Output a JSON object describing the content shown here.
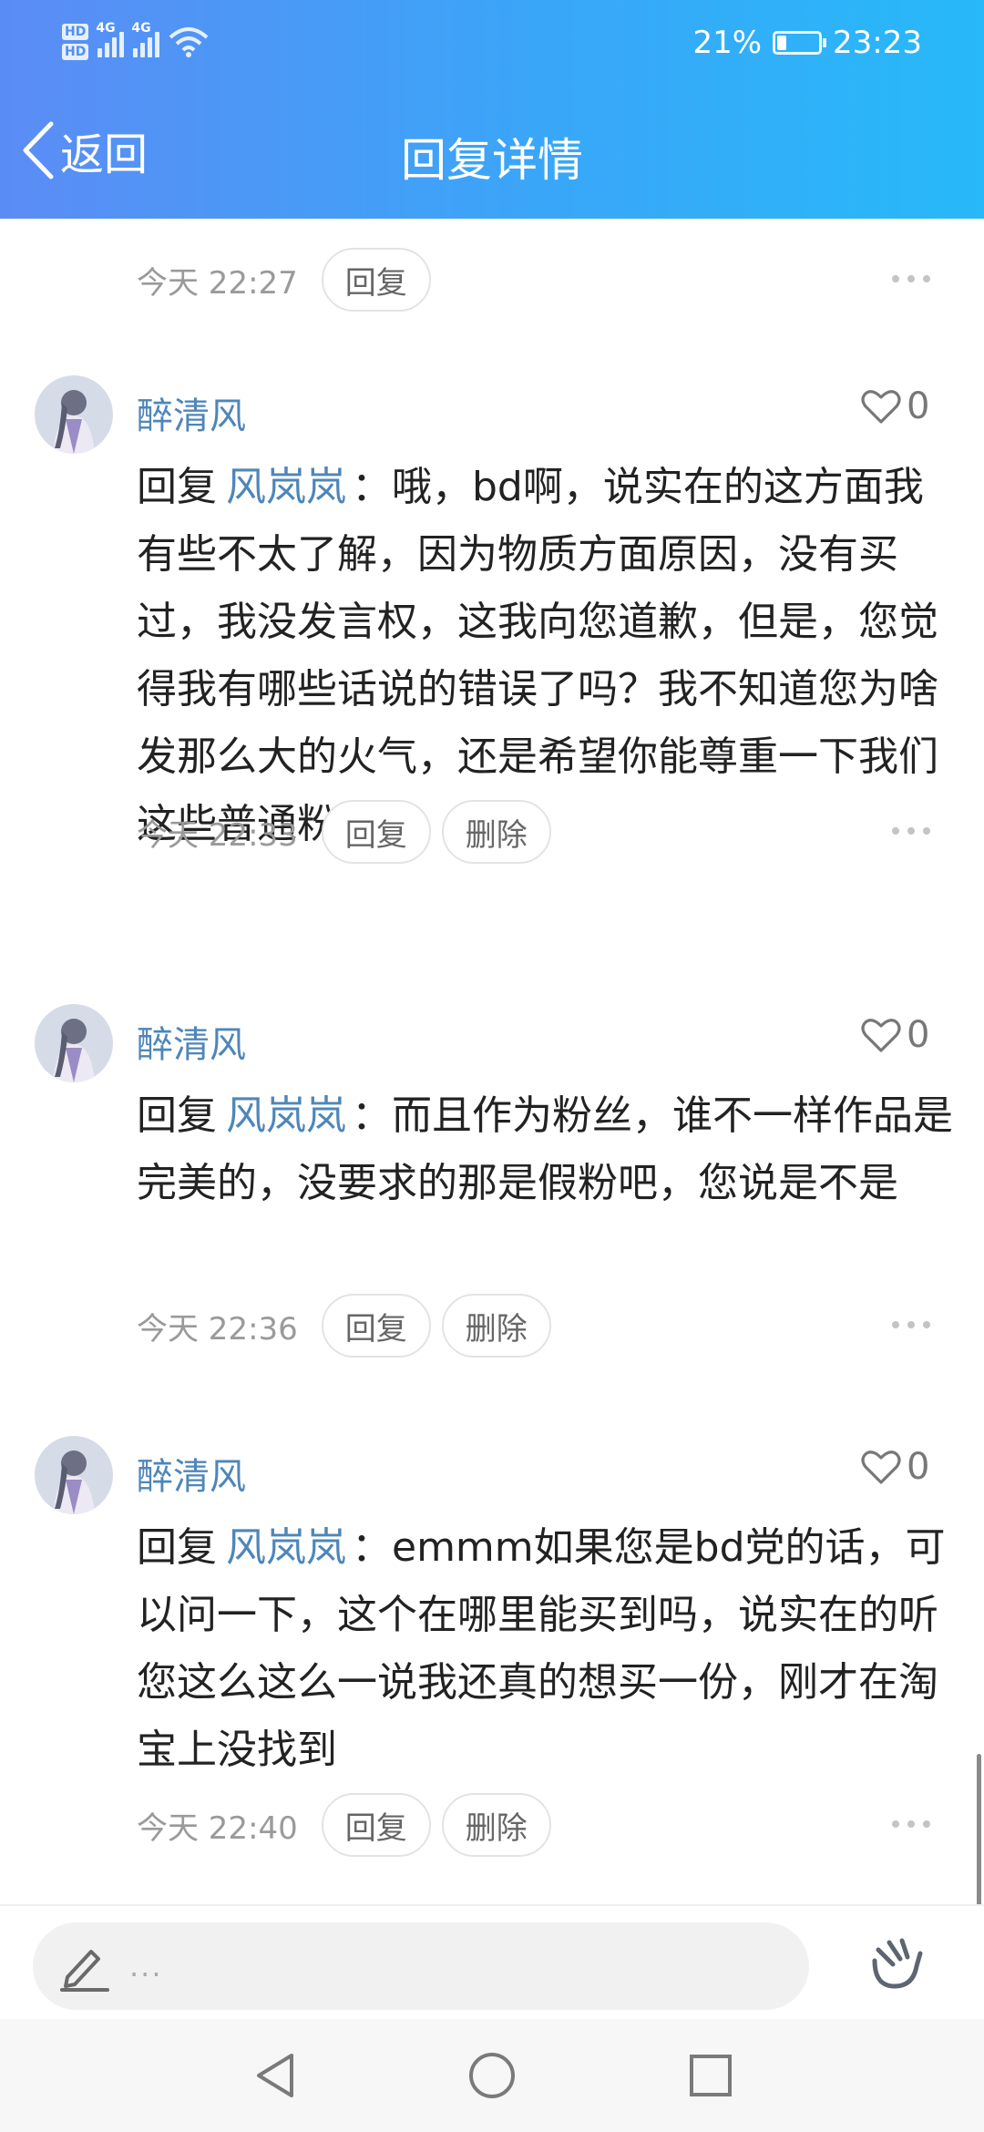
{
  "status_bar": {
    "hd1": "HD",
    "hd2": "HD",
    "net1": "4G",
    "net2": "4G",
    "battery_percent": "21%",
    "battery_level": 0.21,
    "time": "23:23"
  },
  "nav": {
    "back_label": "返回",
    "title": "回复详情"
  },
  "top_partial": {
    "time": "今天 22:27",
    "reply_label": "回复"
  },
  "comments": [
    {
      "name": "醉清风",
      "likes": "0",
      "lead": "回复",
      "to": "风岚岚",
      "text": "：哦，bd啊，说实在的这方面我有些不太了解，因为物质方面原因，没有买过，我没发言权，这我向您道歉，但是，您觉得我有哪些话说的错误了吗？我不知道您为啥发那么大的火气，还是希望你能尊重一下我们这些普通粉丝。",
      "time": "今天 22:33",
      "reply_label": "回复",
      "delete_label": "删除"
    },
    {
      "name": "醉清风",
      "likes": "0",
      "lead": "回复",
      "to": "风岚岚",
      "text": "：而且作为粉丝，谁不一样作品是完美的，没要求的那是假粉吧，您说是不是",
      "time": "今天 22:36",
      "reply_label": "回复",
      "delete_label": "删除"
    },
    {
      "name": "醉清风",
      "likes": "0",
      "lead": "回复",
      "to": "风岚岚",
      "text": "：emmm如果您是bd党的话，可以问一下，这个在哪里能买到吗，说实在的听您这么这么一说我还真的想买一份，刚才在淘宝上没找到",
      "time": "今天 22:40",
      "reply_label": "回复",
      "delete_label": "删除"
    }
  ],
  "input": {
    "placeholder": "..."
  },
  "colors": {
    "header_start": "#5b8cf5",
    "header_end": "#27b9f9",
    "username": "#4e86b9"
  }
}
